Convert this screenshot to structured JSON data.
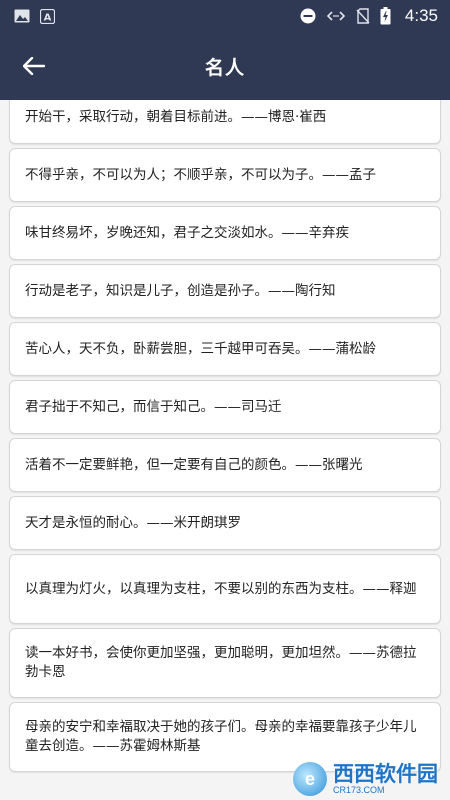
{
  "status_bar": {
    "time": "4:35",
    "left_icons": [
      "image-icon",
      "a-badge-icon"
    ],
    "right_icons": [
      "do-not-disturb-icon",
      "data-arrows-icon",
      "no-sim-icon",
      "battery-charging-icon"
    ]
  },
  "app_bar": {
    "title": "名人",
    "back_icon": "arrow-left-icon",
    "background": "#2f3953"
  },
  "quotes": [
    {
      "text": "开始干，采取行动，朝着目标前进。——博恩·崔西"
    },
    {
      "text": "不得乎亲，不可以为人；不顺乎亲，不可以为子。——孟子"
    },
    {
      "text": "味甘终易坏，岁晚还知，君子之交淡如水。——辛弃疾"
    },
    {
      "text": "行动是老子，知识是儿子，创造是孙子。——陶行知"
    },
    {
      "text": "苦心人，天不负，卧薪尝胆，三千越甲可吞吴。——蒲松龄"
    },
    {
      "text": "君子拙于不知己，而信于知己。——司马迁"
    },
    {
      "text": "活着不一定要鲜艳，但一定要有自己的颜色。——张曙光"
    },
    {
      "text": "天才是永恒的耐心。——米开朗琪罗"
    },
    {
      "text": "以真理为灯火，以真理为支柱，不要以别的东西为支柱。——释迦"
    },
    {
      "text": "读一本好书，会使你更加坚强，更加聪明，更加坦然。——苏德拉勃卡恩"
    },
    {
      "text": "母亲的安宁和幸福取决于她的孩子们。母亲的幸福要靠孩子少年儿童去创造。——苏霍姆林斯基"
    }
  ],
  "watermark": {
    "main": "西西软件园",
    "sub": "CR173.COM"
  }
}
